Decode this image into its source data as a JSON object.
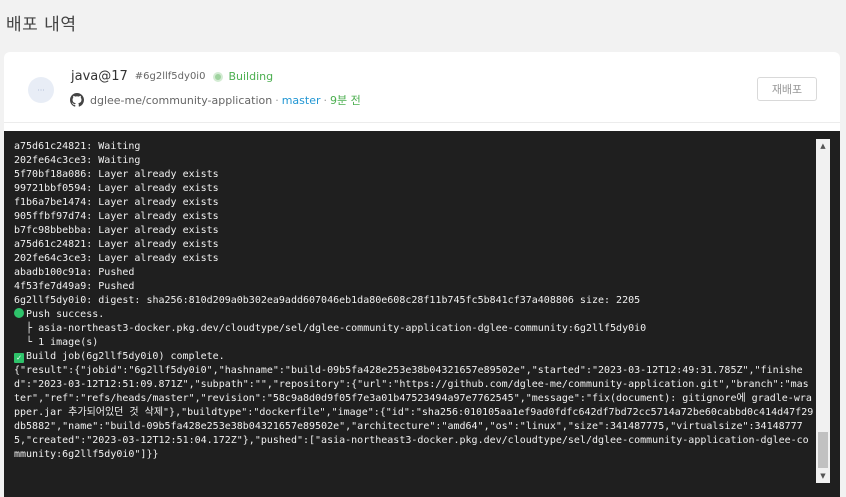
{
  "page": {
    "title": "배포 내역"
  },
  "deployment": {
    "avatar_text": "···",
    "stack": "java@17",
    "job_id": "#6g2llf5dy0i0",
    "status": "Building",
    "status_color": "#4caf50",
    "repo": "dglee-me/community-application",
    "separator": "·",
    "branch": "master",
    "time_ago": "9분 전",
    "redeploy_label": "재배포",
    "repo_icon": "github-icon"
  },
  "console": {
    "lines": [
      "a75d61c24821: Waiting",
      "202fe64c3ce3: Waiting",
      "5f70bf18a086: Layer already exists",
      "99721bbf0594: Layer already exists",
      "f1b6a7be1474: Layer already exists",
      "905ffbf97d74: Layer already exists",
      "b7fc98bbebba: Layer already exists",
      "a75d61c24821: Layer already exists",
      "202fe64c3ce3: Layer already exists",
      "abadb100c91a: Pushed",
      "4f53fe7d49a9: Pushed",
      "6g2llf5dy0i0: digest: sha256:810d209a0b302ea9add607046eb1da80e608c28f11b745fc5b841cf37a408806 size: 2205"
    ],
    "push_success": "Push success.",
    "push_path": "  ├ asia-northeast3-docker.pkg.dev/cloudtype/sel/dglee-community-application-dglee-community:6g2llf5dy0i0",
    "push_count": "  └ 1 image(s)",
    "build_complete": "Build job(6g2llf5dy0i0) complete.",
    "result_json": "{\"result\":{\"jobid\":\"6g2llf5dy0i0\",\"hashname\":\"build-09b5fa428e253e38b04321657e89502e\",\"started\":\"2023-03-12T12:49:31.785Z\",\"finished\":\"2023-03-12T12:51:09.871Z\",\"subpath\":\"\",\"repository\":{\"url\":\"https://github.com/dglee-me/community-application.git\",\"branch\":\"master\",\"ref\":\"refs/heads/master\",\"revision\":\"58c9a8d0d9f05f7e3a01b47523494a97e7762545\",\"message\":\"fix(document): gitignore에 gradle-wrapper.jar 추가되어있던 것 삭제\"},\"buildtype\":\"dockerfile\",\"image\":{\"id\":\"sha256:010105aa1ef9ad0fdfc642df7bd72cc5714a72be60cabbd0c414d47f29db5882\",\"name\":\"build-09b5fa428e253e38b04321657e89502e\",\"architecture\":\"amd64\",\"os\":\"linux\",\"size\":341487775,\"virtualsize\":341487775,\"created\":\"2023-03-12T12:51:04.172Z\"},\"pushed\":[\"asia-northeast3-docker.pkg.dev/cloudtype/sel/dglee-community-application-dglee-community:6g2llf5dy0i0\"]}}",
    "success_color": "#2ec26a"
  },
  "scrollbar": {
    "up_icon": "scroll-up-arrow-icon",
    "down_icon": "scroll-down-arrow-icon"
  }
}
